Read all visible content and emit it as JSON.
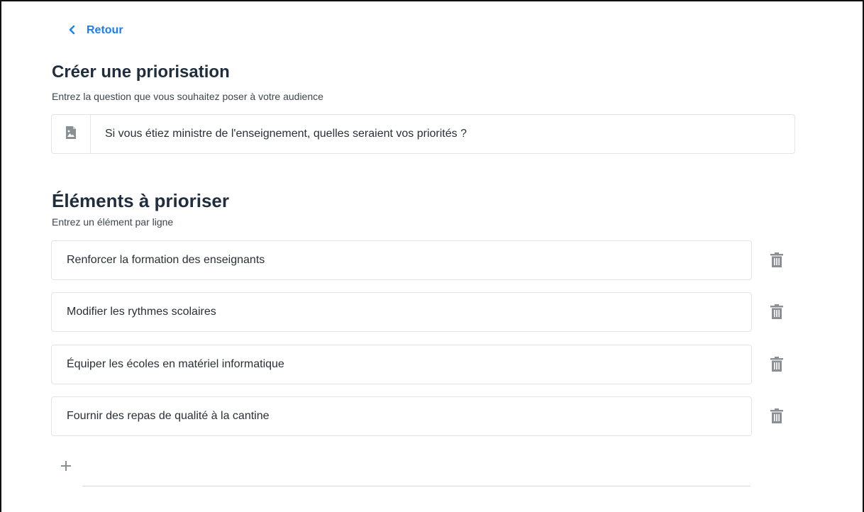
{
  "back": {
    "label": "Retour"
  },
  "question_section": {
    "title": "Créer une priorisation",
    "subtitle": "Entrez la question que vous souhaitez poser à votre audience",
    "question_value": "Si vous étiez ministre de l'enseignement, quelles seraient vos priorités ?",
    "image_icon": "image-file-icon"
  },
  "items_section": {
    "title": "Éléments à prioriser",
    "subtitle": "Entrez un élément par ligne",
    "items": [
      {
        "label": "Renforcer la formation des enseignants"
      },
      {
        "label": "Modifier les rythmes scolaires"
      },
      {
        "label": "Équiper les écoles en matériel informatique"
      },
      {
        "label": "Fournir des repas de qualité à la cantine"
      }
    ],
    "delete_icon": "trash-icon",
    "add_icon": "plus-icon"
  },
  "colors": {
    "accent": "#1a7ff0",
    "text": "#1f2d3d",
    "border": "#e1e4e8",
    "icon_gray": "#8a8f94"
  }
}
